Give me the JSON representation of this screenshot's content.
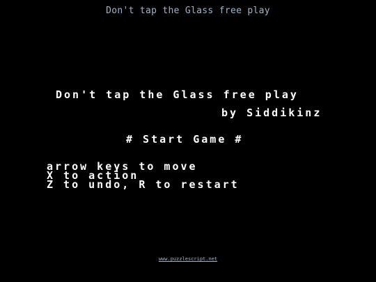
{
  "header": {
    "title": "Don't tap the Glass free play"
  },
  "game": {
    "title": "Don't tap the Glass free play",
    "author": "by Siddikinz",
    "start_option": "# Start Game #",
    "controls": [
      "arrow keys to move",
      "X to action",
      "Z to undo, R to restart"
    ]
  },
  "footer": {
    "link": "www.puzzlescript.net"
  },
  "colors": {
    "background": "#000000",
    "game_text": "#ffffff",
    "chrome_text": "#9fb4c8"
  }
}
